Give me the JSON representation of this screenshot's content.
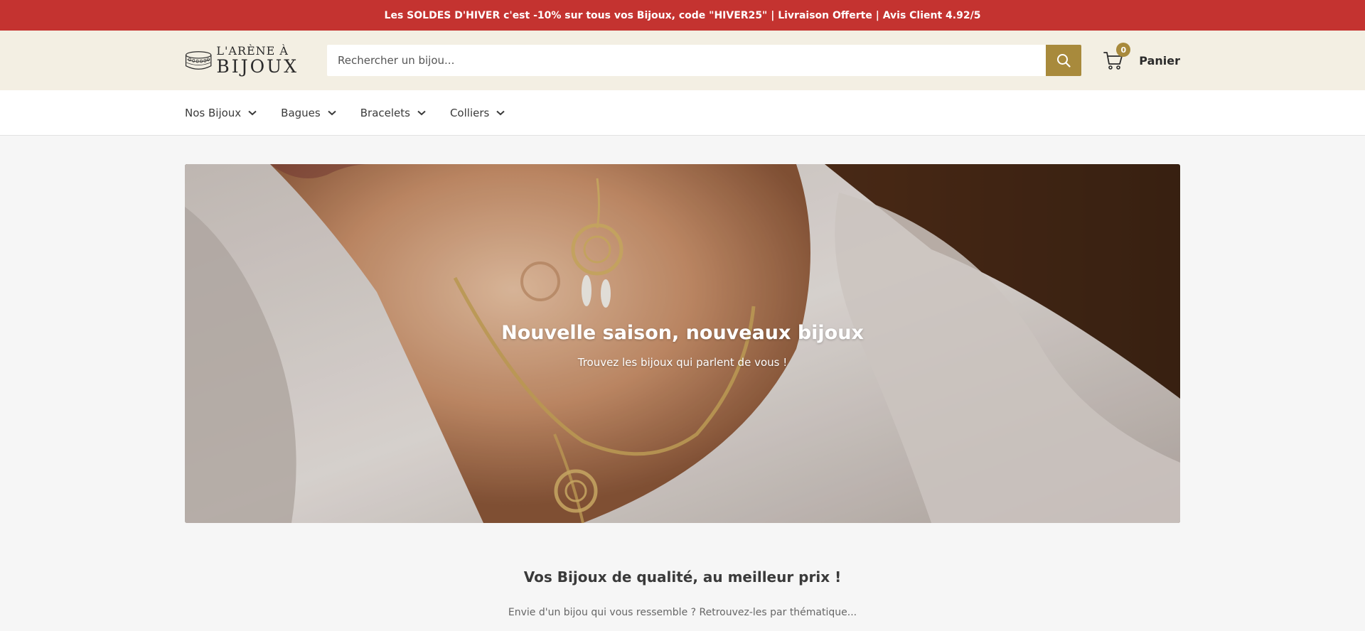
{
  "announcement": {
    "text": "Les SOLDES D'HIVER c'est -10% sur tous vos Bijoux, code \"HIVER25\"   | Livraison Offerte | Avis Client 4.92/5"
  },
  "header": {
    "logo": {
      "line1": "L'ARÈNE À",
      "line2": "BIJOUX"
    },
    "search": {
      "placeholder": "Rechercher un bijou...",
      "value": ""
    },
    "search_icon": "search-icon",
    "cart": {
      "label": "Panier",
      "count": "0",
      "icon": "cart-icon"
    },
    "accent": "#a88a3c"
  },
  "nav": {
    "items": [
      {
        "label": "Nos Bijoux"
      },
      {
        "label": "Bagues"
      },
      {
        "label": "Bracelets"
      },
      {
        "label": "Colliers"
      }
    ]
  },
  "hero": {
    "title": "Nouvelle saison, nouveaux bijoux",
    "subtitle": "Trouvez les bijoux qui parlent de vous !"
  },
  "section": {
    "title": "Vos Bijoux de qualité, au meilleur prix !",
    "subtitle": "Envie d'un bijou qui vous ressemble ? Retrouvez-les par thématique..."
  },
  "colors": {
    "announcement_bg": "#c43330",
    "header_bg": "#f3efe3",
    "page_bg": "#f6f6f6"
  }
}
